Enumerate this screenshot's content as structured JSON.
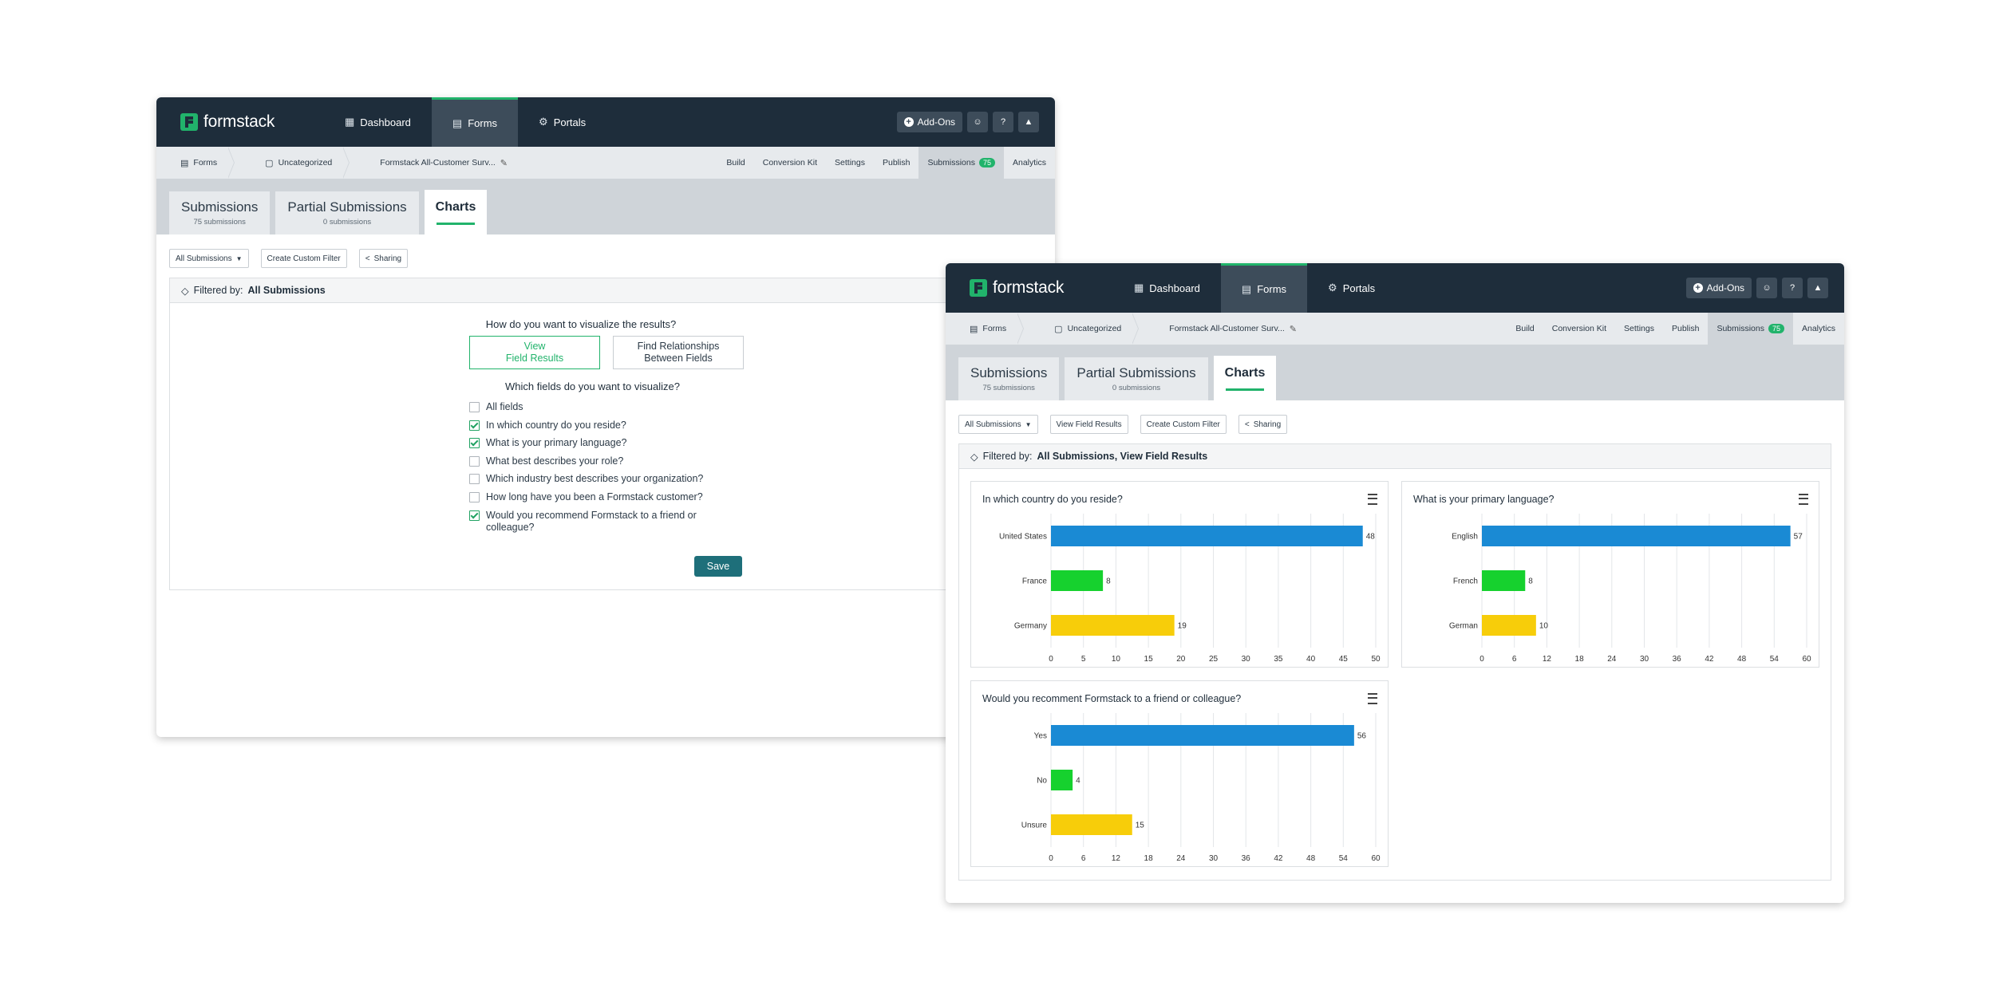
{
  "app": {
    "brand": "formstack",
    "nav": [
      {
        "label": "Dashboard",
        "icon": "dashboard-icon"
      },
      {
        "label": "Forms",
        "icon": "forms-icon"
      },
      {
        "label": "Portals",
        "icon": "portals-icon"
      }
    ],
    "addons_label": "Add-Ons",
    "breadcrumbs": [
      "Forms",
      "Uncategorized",
      "Formstack All-Customer Surv..."
    ],
    "subnav": [
      "Build",
      "Conversion Kit",
      "Settings",
      "Publish",
      "Submissions",
      "Analytics"
    ],
    "submissions_count": "75",
    "tabs": [
      {
        "title": "Submissions",
        "sub": "75 submissions"
      },
      {
        "title": "Partial Submissions",
        "sub": "0 submissions"
      },
      {
        "title": "Charts",
        "sub": ""
      }
    ]
  },
  "left": {
    "toolbar": {
      "filter": "All Submissions",
      "custom": "Create Custom Filter",
      "sharing": "Sharing"
    },
    "filter_label": "Filtered by:",
    "filter_value": "All Submissions",
    "question_visualize": "How do you want to visualize the results?",
    "option_a": "View\nField Results",
    "option_b": "Find Relationships\nBetween Fields",
    "question_fields": "Which fields do you want to visualize?",
    "fields": [
      {
        "label": "All fields",
        "checked": false
      },
      {
        "label": "In which country do you reside?",
        "checked": true
      },
      {
        "label": "What is your primary language?",
        "checked": true
      },
      {
        "label": "What best describes your role?",
        "checked": false
      },
      {
        "label": "Which industry best describes your organization?",
        "checked": false
      },
      {
        "label": "How long have you been a Formstack customer?",
        "checked": false
      },
      {
        "label": "Would you recommend Formstack to a friend or colleague?",
        "checked": true
      }
    ],
    "save_label": "Save"
  },
  "right": {
    "toolbar": {
      "filter": "All Submissions",
      "view": "View Field Results",
      "custom": "Create Custom Filter",
      "sharing": "Sharing"
    },
    "filter_label": "Filtered by:",
    "filter_value": "All Submissions, View Field Results"
  },
  "chart_data": [
    {
      "type": "bar",
      "title": "In which country do you reside?",
      "categories": [
        "United States",
        "France",
        "Germany"
      ],
      "values": [
        48,
        8,
        19
      ],
      "colors": [
        "#1a8ad4",
        "#16d12e",
        "#f7cd0a"
      ],
      "xlim": [
        0,
        50
      ],
      "ticks": [
        0,
        5,
        10,
        15,
        20,
        25,
        30,
        35,
        40,
        45,
        50
      ]
    },
    {
      "type": "bar",
      "title": "What is your primary language?",
      "categories": [
        "English",
        "French",
        "German"
      ],
      "values": [
        57,
        8,
        10
      ],
      "colors": [
        "#1a8ad4",
        "#16d12e",
        "#f7cd0a"
      ],
      "xlim": [
        0,
        60
      ],
      "ticks": [
        0,
        6,
        12,
        18,
        24,
        30,
        36,
        42,
        48,
        54,
        60
      ]
    },
    {
      "type": "bar",
      "title": "Would you recomment Formstack to a friend or colleague?",
      "categories": [
        "Yes",
        "No",
        "Unsure"
      ],
      "values": [
        56,
        4,
        15
      ],
      "colors": [
        "#1a8ad4",
        "#16d12e",
        "#f7cd0a"
      ],
      "xlim": [
        0,
        60
      ],
      "ticks": [
        0,
        6,
        12,
        18,
        24,
        30,
        36,
        42,
        48,
        54,
        60
      ]
    }
  ]
}
